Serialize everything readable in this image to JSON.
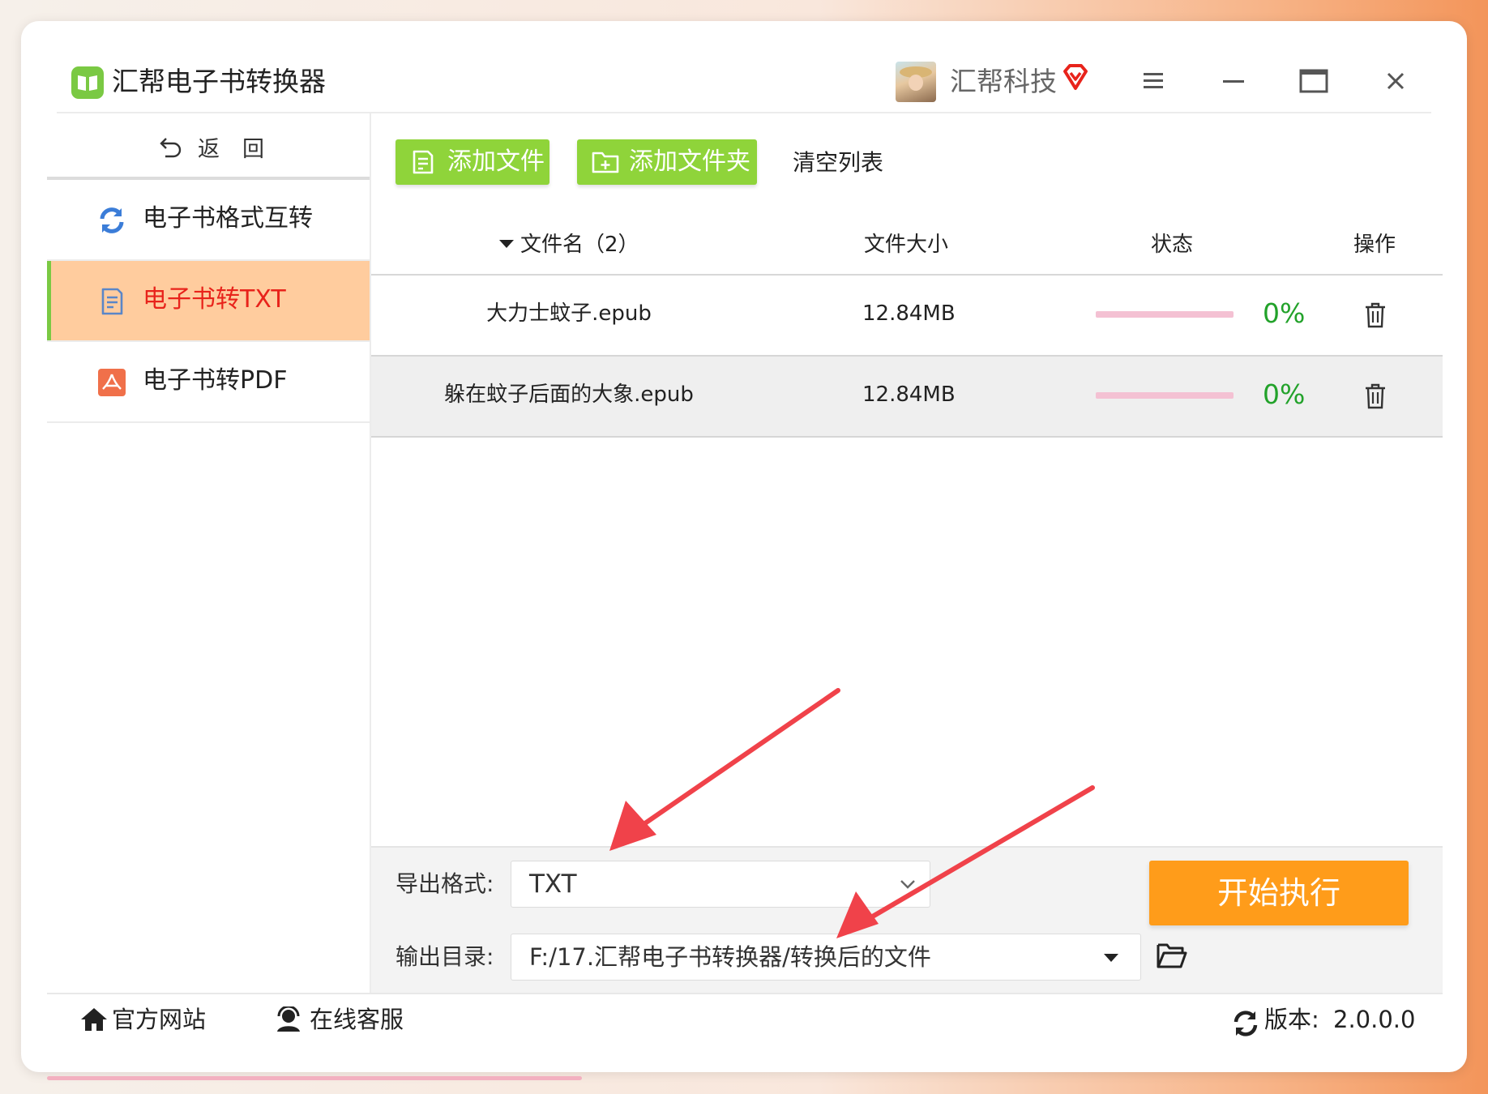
{
  "app": {
    "title": "汇帮电子书转换器"
  },
  "user": {
    "name": "汇帮科技"
  },
  "sidebar": {
    "back_label": "返回",
    "items": [
      {
        "label": "电子书格式互转",
        "icon": "refresh-icon"
      },
      {
        "label": "电子书转TXT",
        "icon": "document-icon",
        "active": true
      },
      {
        "label": "电子书转PDF",
        "icon": "pdf-icon"
      }
    ]
  },
  "toolbar": {
    "add_file_label": "添加文件",
    "add_folder_label": "添加文件夹",
    "clear_label": "清空列表"
  },
  "table": {
    "headers": {
      "name": "文件名（2）",
      "size": "文件大小",
      "status": "状态",
      "action": "操作"
    },
    "rows": [
      {
        "name": "大力士蚊子.epub",
        "size": "12.84MB",
        "progress": 0,
        "percent": "0%"
      },
      {
        "name": "躲在蚊子后面的大象.epub",
        "size": "12.84MB",
        "progress": 0,
        "percent": "0%"
      }
    ]
  },
  "output": {
    "format_label": "导出格式:",
    "format_value": "TXT",
    "dir_label": "输出目录:",
    "dir_value": "F:/17.汇帮电子书转换器/转换后的文件",
    "start_label": "开始执行"
  },
  "footer": {
    "website_label": "官方网站",
    "support_label": "在线客服",
    "version_label": "版本:",
    "version_value": "2.0.0.0"
  },
  "colors": {
    "accent_green": "#8fd43a",
    "active_bg": "#ffcc9e",
    "active_text": "#e8231b",
    "start_orange": "#ff9c1a",
    "percent_green": "#22a22a",
    "annotation_red": "#f0424a"
  }
}
